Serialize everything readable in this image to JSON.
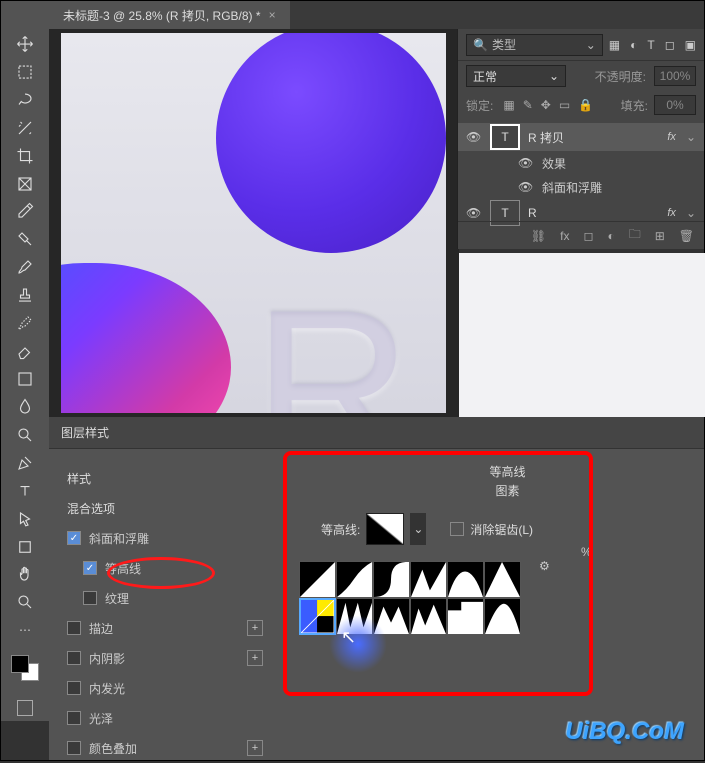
{
  "document": {
    "tab_title": "未标题-3 @ 25.8% (R 拷贝, RGB/8) *",
    "close": "×"
  },
  "layers_panel": {
    "search_placeholder": "类型",
    "blend_mode": "正常",
    "opacity_label": "不透明度:",
    "opacity_value": "100%",
    "lock_label": "锁定:",
    "fill_label": "填充:",
    "fill_value": "0%",
    "layer1": {
      "name": "R 拷贝",
      "fx": "fx"
    },
    "effects_label": "效果",
    "bevel_label": "斜面和浮雕",
    "layer2": {
      "name": "R",
      "fx": "fx"
    }
  },
  "layer_style": {
    "title": "图层样式",
    "styles_head": "样式",
    "blend_options": "混合选项",
    "items": {
      "bevel": "斜面和浮雕",
      "contour": "等高线",
      "texture": "纹理",
      "stroke": "描边",
      "inner_shadow": "内阴影",
      "inner_glow": "内发光",
      "satin": "光泽",
      "color_overlay": "颜色叠加"
    },
    "contour_section": {
      "head1": "等高线",
      "head2": "图素",
      "label": "等高线:",
      "antialias": "消除锯齿(L)",
      "percent": "%"
    }
  },
  "watermark": "UiBQ.CoM"
}
